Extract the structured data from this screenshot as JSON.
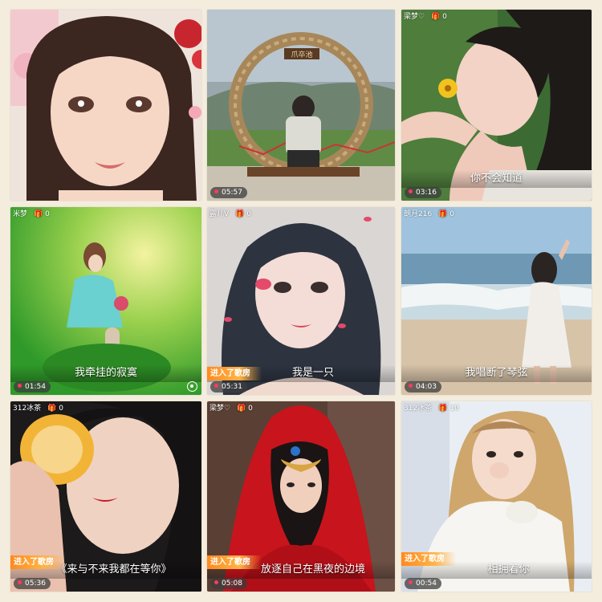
{
  "tiles": [
    {
      "timer": "",
      "caption": ""
    },
    {
      "timer": "05:57",
      "caption": "",
      "sign": "爪卒池"
    },
    {
      "user": "梁梦♡",
      "gift": "0",
      "timer": "03:16",
      "caption": "你不会知道"
    },
    {
      "user": "米梦",
      "gift": "0",
      "timer": "01:54",
      "caption": "我牵挂的寂寞"
    },
    {
      "user": "露儿V",
      "gift": "0",
      "timer": "05:31",
      "caption": "我是一只",
      "enter": "进入了歌房"
    },
    {
      "user": "朗月216",
      "gift": "0",
      "timer": "04:03",
      "caption": "我唱断了琴弦"
    },
    {
      "user": "312冰茶",
      "gift": "0",
      "timer": "05:36",
      "caption": "《来与不来我都在等你》",
      "enter": "进入了歌房"
    },
    {
      "user": "梁梦♡",
      "gift": "0",
      "timer": "05:08",
      "caption": "放逐自己在黑夜的边境",
      "enter": "进入了歌房"
    },
    {
      "user": "312冰茶",
      "gift": "10",
      "timer": "00:54",
      "caption": "相拥着你",
      "enter": "进入了歌房"
    }
  ],
  "icons": {
    "gift": "gift-icon",
    "location": "location-icon",
    "record_dot": "record-dot-icon"
  },
  "colors": {
    "background": "#f4ecdc",
    "enter_badge": "#ff8a1e",
    "record_dot": "#ff3b5c"
  }
}
